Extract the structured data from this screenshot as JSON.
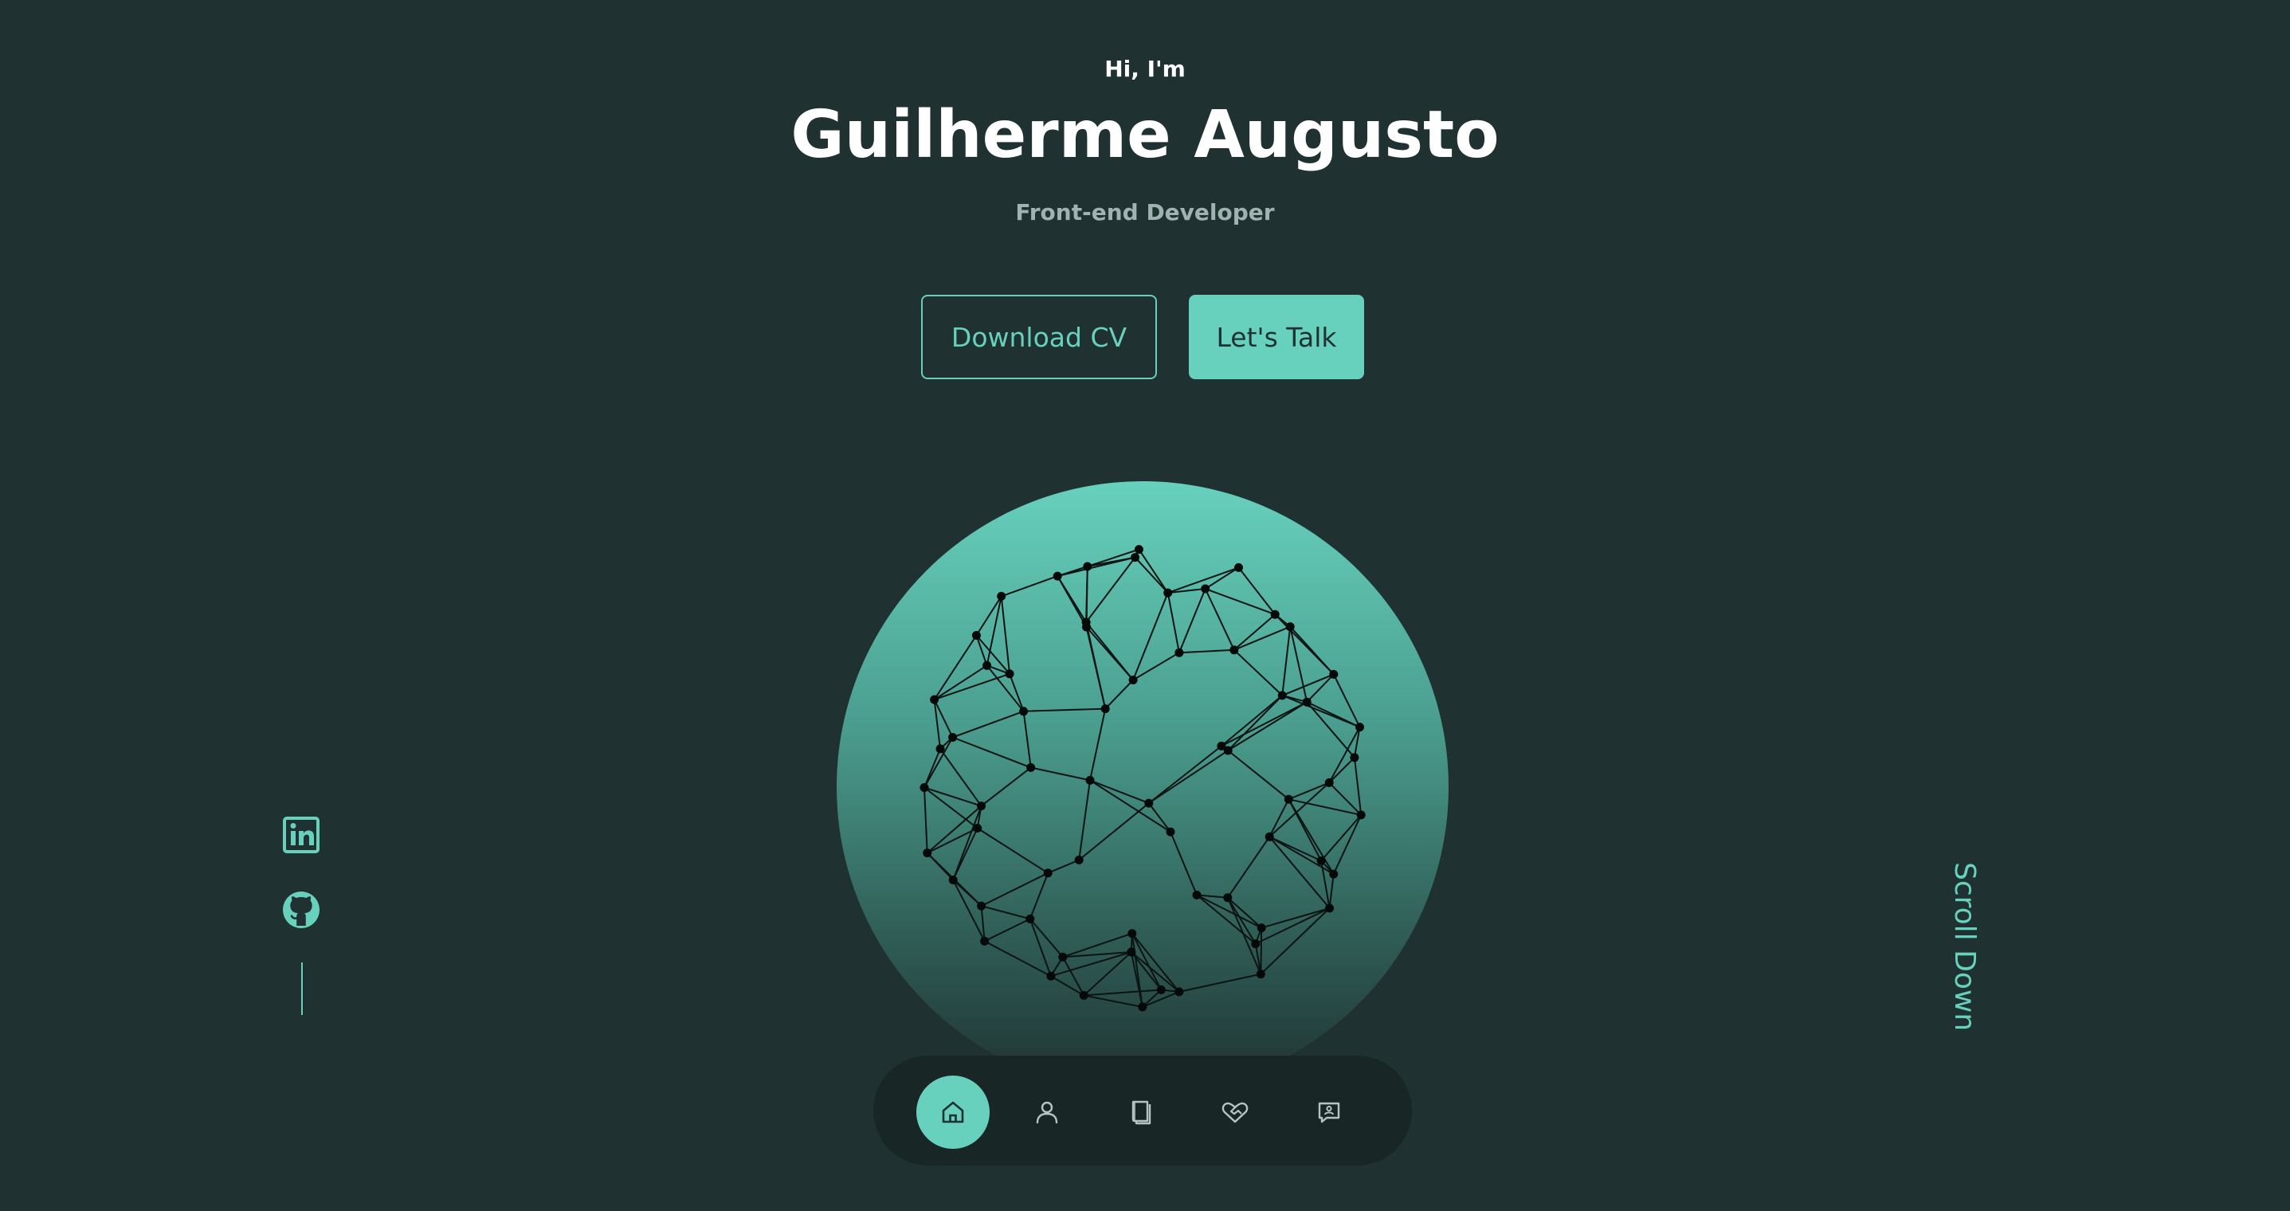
{
  "hero": {
    "greeting": "Hi, I'm",
    "name": "Guilherme Augusto",
    "role": "Front-end Developer"
  },
  "buttons": {
    "download_cv": "Download CV",
    "lets_talk": "Let's Talk"
  },
  "socials": [
    {
      "icon": "linkedin-icon"
    },
    {
      "icon": "github-icon"
    }
  ],
  "scroll": {
    "label": "Scroll Down"
  },
  "nav": {
    "items": [
      {
        "icon": "home-icon",
        "active": true
      },
      {
        "icon": "user-icon",
        "active": false
      },
      {
        "icon": "book-icon",
        "active": false
      },
      {
        "icon": "handshake-icon",
        "active": false
      },
      {
        "icon": "contact-icon",
        "active": false
      }
    ]
  },
  "colors": {
    "background": "#1f3131",
    "accent": "#67d1bd",
    "nav_background": "#182625",
    "muted_text": "#9fb3b0"
  }
}
